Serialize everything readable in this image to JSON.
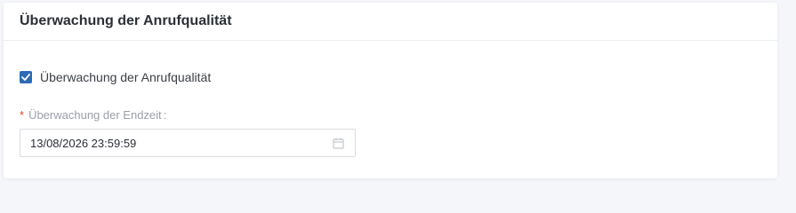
{
  "card": {
    "title": "Überwachung der Anrufqualität"
  },
  "monitoring_checkbox": {
    "label": "Überwachung der Anrufqualität",
    "checked": true
  },
  "end_time_field": {
    "required_marker": "*",
    "label": "Überwachung der Endzeit",
    "colon": ":",
    "value": "13/08/2026 23:59:59",
    "icon": "calendar-icon"
  },
  "colors": {
    "accent": "#2d6ab4",
    "required": "#e0452f"
  }
}
